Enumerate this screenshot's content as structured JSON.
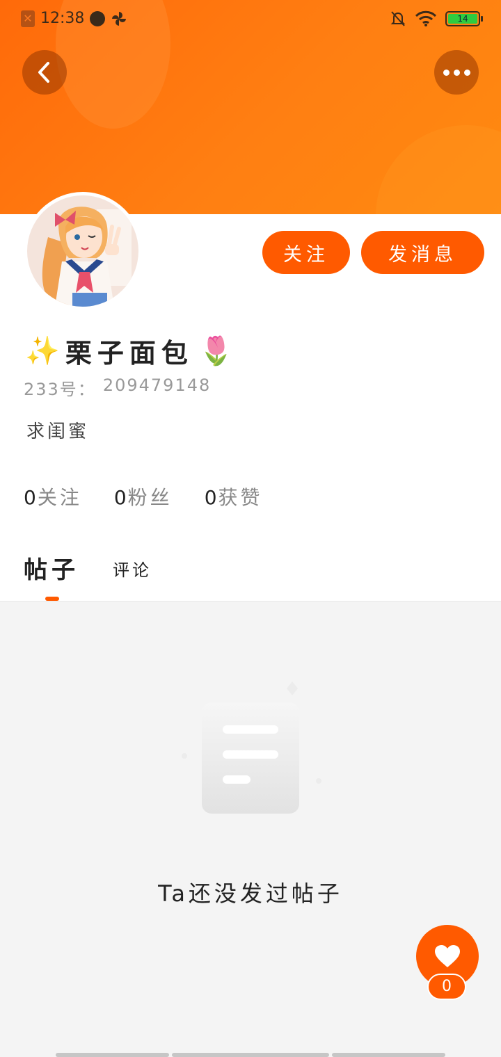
{
  "status_bar": {
    "time": "12:38",
    "battery": "14",
    "icons": [
      "app-notification-icon",
      "planet-icon",
      "pinwheel-icon",
      "mute-bell-icon",
      "wifi-icon",
      "battery-icon"
    ]
  },
  "header": {
    "back_icon": "chevron-left-icon",
    "more_icon": "more-dots-icon",
    "colors": {
      "gradient_start": "#ff6a0a",
      "gradient_end": "#ff8a10"
    }
  },
  "profile": {
    "avatar_desc": "anime-girl-avatar",
    "name_prefix_emoji": "✨",
    "name": "栗子面包",
    "name_suffix_emoji": "🌷",
    "account_label": "233号：",
    "account_id": "209479148",
    "bio": "求闺蜜",
    "follow_label": "关注",
    "message_label": "发消息"
  },
  "stats": [
    {
      "count": "0",
      "label": "关注"
    },
    {
      "count": "0",
      "label": "粉丝"
    },
    {
      "count": "0",
      "label": "获赞"
    }
  ],
  "tabs": {
    "posts_label": "帖子",
    "comments_label": "评论",
    "active": "posts"
  },
  "empty_state": {
    "icon": "empty-document-icon",
    "message": "Ta还没发过帖子"
  },
  "like_fab": {
    "icon": "heart-icon",
    "count": "0"
  },
  "accent_color": "#ff5a00"
}
